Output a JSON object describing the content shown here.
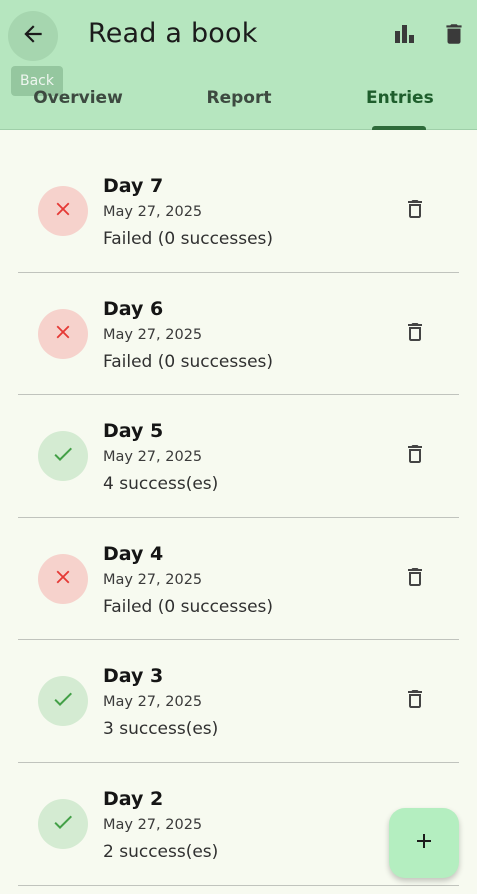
{
  "app": {
    "title": "Read a book",
    "back_tooltip": "Back",
    "back_icon": "arrow-left-icon",
    "chart_icon": "bar-chart-icon",
    "delete_icon": "trash-icon"
  },
  "tabs": [
    {
      "label": "Overview",
      "selected": false
    },
    {
      "label": "Report",
      "selected": false
    },
    {
      "label": "Entries",
      "selected": true
    }
  ],
  "colors": {
    "appbar": "#b6e6bf",
    "background": "#f7faf0",
    "failed": "#e53935",
    "failed_bg": "#f6d2cc",
    "success": "#43a047",
    "success_bg": "#d4ebd2",
    "fab": "#b4eec0"
  },
  "entries": [
    {
      "title": "Day 7",
      "date": "May 27, 2025",
      "detail": "Failed (0 successes)",
      "status": "failed"
    },
    {
      "title": "Day 6",
      "date": "May 27, 2025",
      "detail": "Failed (0 successes)",
      "status": "failed"
    },
    {
      "title": "Day 5",
      "date": "May 27, 2025",
      "detail": "4 success(es)",
      "status": "success"
    },
    {
      "title": "Day 4",
      "date": "May 27, 2025",
      "detail": "Failed (0 successes)",
      "status": "failed"
    },
    {
      "title": "Day 3",
      "date": "May 27, 2025",
      "detail": "3 success(es)",
      "status": "success"
    },
    {
      "title": "Day 2",
      "date": "May 27, 2025",
      "detail": "2 success(es)",
      "status": "success"
    }
  ],
  "fab": {
    "icon": "plus-icon"
  }
}
